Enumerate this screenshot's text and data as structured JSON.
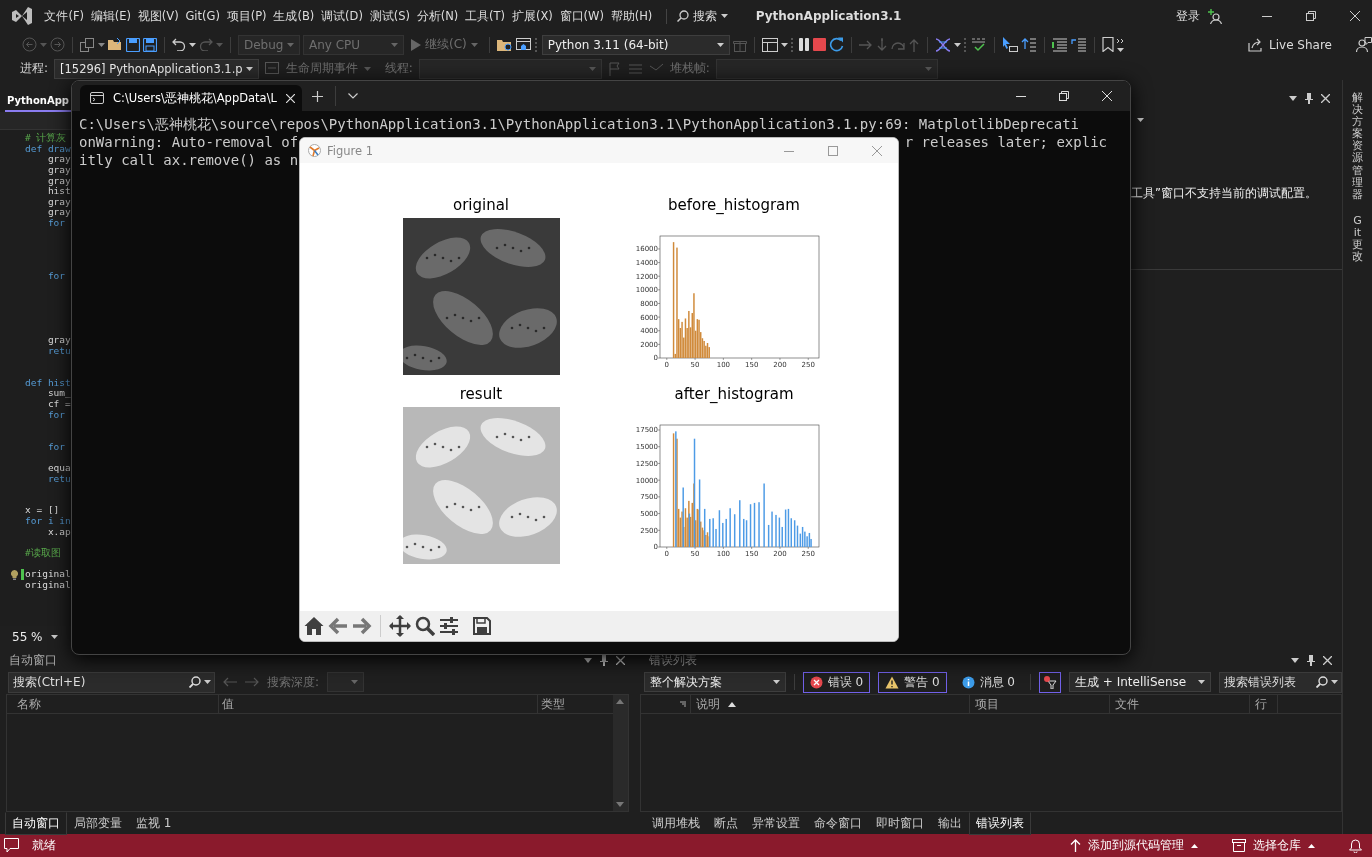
{
  "title_bar": {
    "menu": [
      "文件(F)",
      "编辑(E)",
      "视图(V)",
      "Git(G)",
      "项目(P)",
      "生成(B)",
      "调试(D)",
      "测试(S)",
      "分析(N)",
      "工具(T)",
      "扩展(X)",
      "窗口(W)",
      "帮助(H)"
    ],
    "search": "搜索",
    "title": "PythonApplication3.1",
    "login": "登录"
  },
  "toolbar": {
    "configuration": {
      "value": "Debug",
      "disabled": true
    },
    "platform": {
      "value": "Any CPU",
      "disabled": true
    },
    "continue": {
      "label": "继续(C)",
      "disabled": true
    },
    "environment": {
      "value": "Python 3.11 (64-bit)",
      "disabled": false
    },
    "live_share": "Live Share"
  },
  "debug_bar": {
    "process_label": "进程:",
    "process": "[15296] PythonApplication3.1.p",
    "lifecycle": "生命周期事件",
    "thread_label": "线程:",
    "stack_label": "堆栈帧:"
  },
  "editor": {
    "tab": "PythonApp",
    "zoom": "55 %",
    "lines": [
      {
        "text": "# 计算灰",
        "kind": "comment",
        "lightbulb": false,
        "modified": false
      },
      {
        "text": "def draw",
        "kind": "keyword",
        "lightbulb": false,
        "modified": false
      },
      {
        "text": "    gray",
        "kind": "code",
        "lightbulb": false,
        "modified": false
      },
      {
        "text": "    gray",
        "kind": "code",
        "lightbulb": false,
        "modified": false
      },
      {
        "text": "    gray",
        "kind": "code",
        "lightbulb": false,
        "modified": false
      },
      {
        "text": "    hist",
        "kind": "code",
        "lightbulb": false,
        "modified": false
      },
      {
        "text": "    gray",
        "kind": "code",
        "lightbulb": false,
        "modified": false
      },
      {
        "text": "    gray",
        "kind": "code",
        "lightbulb": false,
        "modified": false
      },
      {
        "text": "    for",
        "kind": "keyword",
        "lightbulb": false,
        "modified": false
      },
      {
        "kind": "covered"
      },
      {
        "kind": "covered"
      },
      {
        "kind": "covered"
      },
      {
        "kind": "covered"
      },
      {
        "text": "    for",
        "kind": "keyword",
        "lightbulb": false,
        "modified": false
      },
      {
        "kind": "covered"
      },
      {
        "kind": "covered"
      },
      {
        "kind": "covered"
      },
      {
        "kind": "covered"
      },
      {
        "kind": "covered"
      },
      {
        "text": "    gray",
        "kind": "code",
        "lightbulb": false,
        "modified": false
      },
      {
        "text": "    retu",
        "kind": "keyword",
        "lightbulb": false,
        "modified": false
      },
      {
        "kind": "covered"
      },
      {
        "kind": "covered"
      },
      {
        "text": "def hist",
        "kind": "keyword",
        "lightbulb": false,
        "modified": false
      },
      {
        "text": "    sum_",
        "kind": "code",
        "lightbulb": false,
        "modified": false
      },
      {
        "text": "    cf =",
        "kind": "code",
        "lightbulb": false,
        "modified": false
      },
      {
        "text": "    for",
        "kind": "keyword",
        "lightbulb": false,
        "modified": false
      },
      {
        "kind": "covered"
      },
      {
        "kind": "covered"
      },
      {
        "text": "    for",
        "kind": "keyword",
        "lightbulb": false,
        "modified": false
      },
      {
        "kind": "covered"
      },
      {
        "text": "    equa",
        "kind": "code",
        "lightbulb": false,
        "modified": false
      },
      {
        "text": "    retu",
        "kind": "keyword",
        "lightbulb": false,
        "modified": false
      },
      {
        "kind": "covered"
      },
      {
        "kind": "covered"
      },
      {
        "text": "x = []",
        "kind": "code",
        "lightbulb": false,
        "modified": false
      },
      {
        "text": "for i in",
        "kind": "keyword",
        "lightbulb": false,
        "modified": false
      },
      {
        "text": "    x.ap",
        "kind": "code",
        "lightbulb": false,
        "modified": false
      },
      {
        "kind": "covered"
      },
      {
        "text": "#读取图",
        "kind": "comment",
        "lightbulb": false,
        "modified": false
      },
      {
        "kind": "covered"
      },
      {
        "text": "original",
        "kind": "code",
        "lightbulb": true,
        "modified": true
      },
      {
        "text": "original",
        "kind": "code",
        "lightbulb": false,
        "modified": false
      }
    ]
  },
  "solution_panel": {
    "message": "工具”窗口不支持当前的调试配置。"
  },
  "side_tabs": [
    "解决方案资源管理器",
    "Git 更改"
  ],
  "autos": {
    "title": "自动窗口",
    "search_placeholder": "搜索(Ctrl+E)",
    "depth_label": "搜索深度:",
    "columns": [
      "名称",
      "值",
      "类型"
    ],
    "tabs": [
      {
        "label": "自动窗口",
        "selected": true
      },
      {
        "label": "局部变量",
        "selected": false
      },
      {
        "label": "监视 1",
        "selected": false
      }
    ]
  },
  "error_list": {
    "title": "错误列表",
    "scope": "整个解决方案",
    "filters": [
      {
        "kind": "error",
        "label": "错误 0",
        "selected": true
      },
      {
        "kind": "warning",
        "label": "警告 0",
        "selected": true
      },
      {
        "kind": "message",
        "label": "消息 0",
        "selected": false
      }
    ],
    "filter_button": {
      "selected": true
    },
    "source": "生成 + IntelliSense",
    "search_placeholder": "搜索错误列表",
    "columns": [
      {
        "label": "说明",
        "sorted": true
      },
      {
        "label": "项目",
        "sorted": false
      },
      {
        "label": "文件",
        "sorted": false
      },
      {
        "label": "行",
        "sorted": false
      }
    ],
    "tabs": [
      {
        "label": "调用堆栈",
        "selected": false
      },
      {
        "label": "断点",
        "selected": false
      },
      {
        "label": "异常设置",
        "selected": false
      },
      {
        "label": "命令窗口",
        "selected": false
      },
      {
        "label": "即时窗口",
        "selected": false
      },
      {
        "label": "输出",
        "selected": false
      },
      {
        "label": "错误列表",
        "selected": true
      }
    ]
  },
  "status_bar": {
    "text": "就绪",
    "source_control": "添加到源代码管理",
    "repository": "选择仓库"
  },
  "terminal": {
    "tab": "C:\\Users\\恶神桃花\\AppData\\L",
    "lines": [
      {
        "left": "C:\\Users\\恶神桃花\\source\\repos\\PythonApplication3.1\\PythonApplication3.1\\PythonApplication3.1.py:69: MatplotlibDeprecati"
      },
      {
        "left": "onWarning: Auto-removal of",
        "right": "r releases later; explic"
      },
      {
        "left": "itly call ax.remove() as n"
      }
    ]
  },
  "figure": {
    "title": "Figure 1",
    "panels": [
      {
        "kind": "image",
        "title": "original"
      },
      {
        "kind": "chart",
        "title": "before_histogram",
        "chart_data": {
          "type": "bar",
          "x": [
            12,
            15,
            18,
            21,
            24,
            27,
            30,
            33,
            36,
            39,
            42,
            45,
            48,
            51,
            54,
            57,
            60,
            63,
            66,
            69,
            72,
            75
          ],
          "series": [
            {
              "color": "#d08a3a",
              "values": [
                17000,
                600,
                16200,
                5700,
                4400,
                5300,
                3000,
                5800,
                4400,
                6900,
                4500,
                6600,
                9500,
                4000,
                5700,
                5600,
                3800,
                2900,
                2500,
                1800,
                2200,
                1600
              ]
            }
          ],
          "xlim": [
            -12,
            269
          ],
          "ylim": [
            0,
            17900
          ],
          "xticks": [
            0,
            50,
            100,
            150,
            200,
            250
          ],
          "yticks": [
            0,
            2000,
            4000,
            6000,
            8000,
            10000,
            12000,
            14000,
            16000
          ]
        }
      },
      {
        "kind": "image",
        "title": "result"
      },
      {
        "kind": "chart",
        "title": "after_histogram",
        "chart_data": {
          "type": "bar",
          "x": [
            12,
            16,
            18,
            21,
            24,
            27,
            29,
            30,
            33,
            36,
            39,
            40,
            42,
            45,
            48,
            49,
            51,
            54,
            57,
            58,
            60,
            63,
            66,
            67,
            69,
            72,
            75,
            76,
            82,
            87,
            93,
            99,
            105,
            112,
            120,
            129,
            136,
            141,
            148,
            155,
            163,
            172,
            180,
            186,
            193,
            199,
            204,
            210,
            215,
            220,
            226,
            231,
            236,
            240,
            244,
            248,
            252,
            255
          ],
          "series": [
            {
              "color": "#d08a3a",
              "values": [
                17000,
                null,
                16200,
                5700,
                4400,
                5300,
                null,
                3000,
                5800,
                4400,
                6900,
                null,
                4500,
                6600,
                9500,
                null,
                4000,
                5700,
                5600,
                null,
                3800,
                2900,
                2500,
                null,
                1800,
                2200,
                1600,
                null,
                null,
                null,
                null,
                null,
                null,
                null,
                null,
                null,
                null,
                null,
                null,
                null,
                null,
                null,
                null,
                null,
                null,
                null,
                null,
                null,
                null,
                null,
                null,
                null,
                null,
                null,
                null,
                null,
                null,
                null
              ]
            },
            {
              "color": "#4d9be6",
              "values": [
                null,
                17300,
                null,
                null,
                null,
                null,
                8900,
                null,
                null,
                null,
                null,
                5000,
                null,
                null,
                null,
                16200,
                null,
                null,
                null,
                10100,
                null,
                null,
                null,
                5700,
                null,
                null,
                null,
                4200,
                4300,
                2700,
                5500,
                3600,
                4200,
                5800,
                4900,
                7000,
                4200,
                4000,
                6400,
                6600,
                6700,
                9500,
                3300,
                5300,
                4800,
                4400,
                3000,
                5600,
                5700,
                4300,
                4000,
                3200,
                2000,
                3000,
                2300,
                1600,
                2100,
                1200
              ]
            }
          ],
          "xlim": [
            -12,
            269
          ],
          "ylim": [
            0,
            18250
          ],
          "xticks": [
            0,
            50,
            100,
            150,
            200,
            250
          ],
          "yticks": [
            0,
            2500,
            5000,
            7500,
            10000,
            12500,
            15000,
            17500
          ]
        }
      }
    ]
  }
}
